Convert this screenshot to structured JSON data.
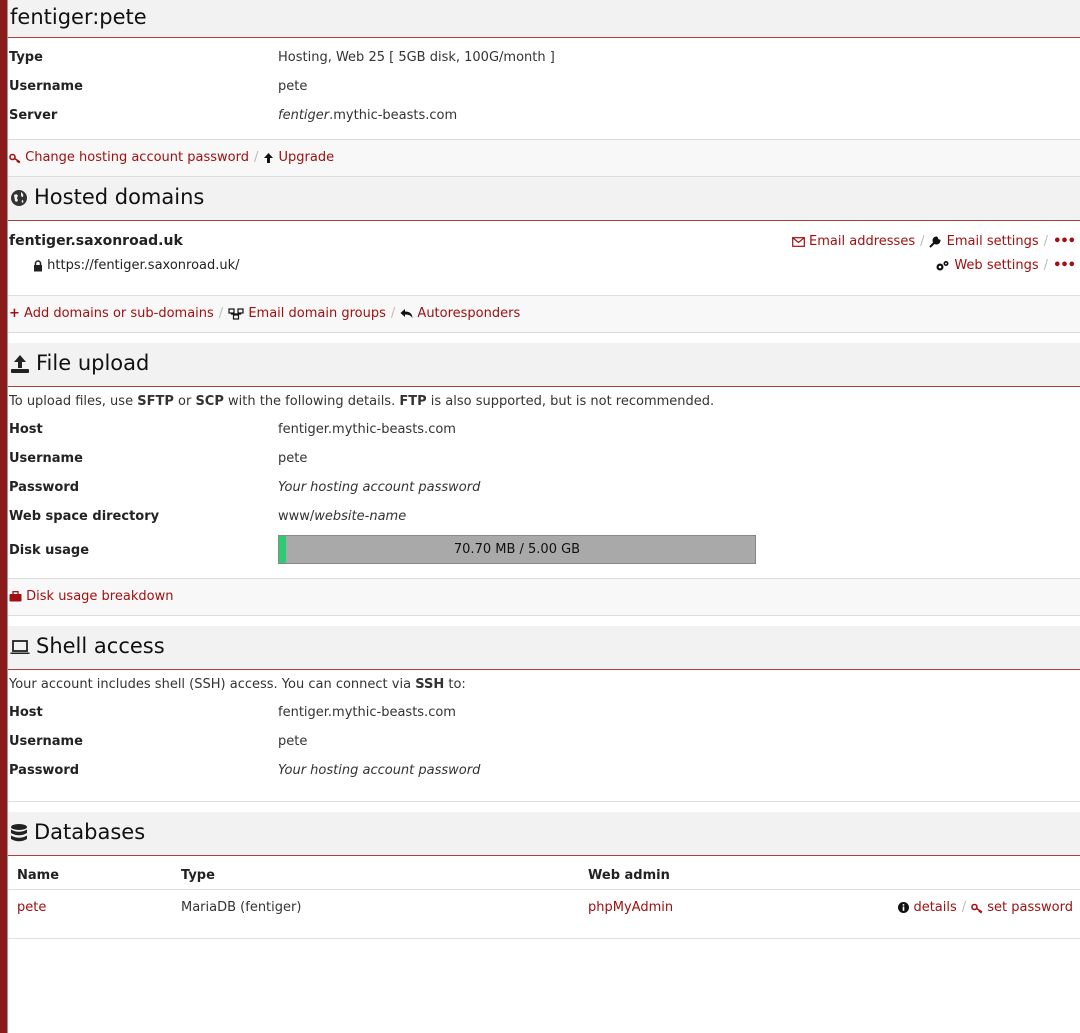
{
  "account": {
    "title": "fentiger:pete",
    "rows": [
      {
        "key": "Type",
        "value": "Hosting, Web 25 [ 5GB disk, 100G/month ]"
      },
      {
        "key": "Username",
        "value": "pete"
      },
      {
        "key": "Server",
        "value_italic": "fentiger",
        "value_rest": ".mythic-beasts.com"
      }
    ],
    "actions": {
      "change_password": "Change hosting account password",
      "upgrade": "Upgrade"
    }
  },
  "hosted": {
    "title": "Hosted domains",
    "domain": "fentiger.saxonroad.uk",
    "url": "https://fentiger.saxonroad.uk/",
    "email_addresses": "Email addresses",
    "email_settings": "Email settings",
    "web_settings": "Web settings",
    "more": "•••",
    "actions": {
      "add_domains": "Add domains or sub-domains",
      "email_groups": "Email domain groups",
      "autoresponders": "Autoresponders"
    }
  },
  "upload": {
    "title": "File upload",
    "note": {
      "pre": "To upload files, use ",
      "sftp": "SFTP",
      "or": " or ",
      "scp": "SCP",
      "mid": " with the following details. ",
      "ftp": "FTP",
      "post": " is also supported, but is not recommended."
    },
    "host_label": "Host",
    "host": "fentiger.mythic-beasts.com",
    "username_label": "Username",
    "username": "pete",
    "password_label": "Password",
    "password": "Your hosting account password",
    "webspace_label": "Web space directory",
    "webspace_prefix": "www/",
    "webspace_italic": "website-name",
    "disk_label": "Disk usage",
    "disk_text": "70.70 MB / 5.00 GB",
    "disk_fraction": 0.0138,
    "breakdown": "Disk usage breakdown"
  },
  "shell": {
    "title": "Shell access",
    "note": {
      "pre": "Your account includes shell (SSH) access. You can connect via ",
      "ssh": "SSH",
      "post": " to:"
    },
    "host_label": "Host",
    "host": "fentiger.mythic-beasts.com",
    "username_label": "Username",
    "username": "pete",
    "password_label": "Password",
    "password": "Your hosting account password"
  },
  "databases": {
    "title": "Databases",
    "columns": [
      "Name",
      "Type",
      "Web admin"
    ],
    "rows": [
      {
        "name": "pete",
        "type": "MariaDB (fentiger)",
        "admin": "phpMyAdmin",
        "details": "details",
        "set_password": "set password"
      }
    ]
  },
  "colors": {
    "accent": "#a01010",
    "frame": "#8b1a1a",
    "progress": "#2ecc71"
  }
}
